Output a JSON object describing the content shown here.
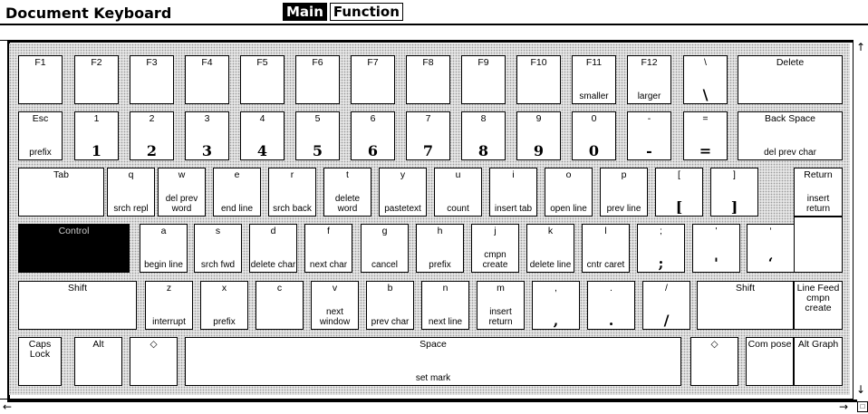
{
  "window": {
    "title": "Document Keyboard"
  },
  "tabs": [
    {
      "label": "Main",
      "active": true
    },
    {
      "label": "Function",
      "active": false
    }
  ],
  "scroll": {
    "up": "↑",
    "down": "↓",
    "left": "←",
    "right": "→",
    "corner": "□"
  },
  "keys": [
    {
      "name": "key-f1",
      "top": "F1",
      "bottom": ""
    },
    {
      "name": "key-f2",
      "top": "F2",
      "bottom": ""
    },
    {
      "name": "key-f3",
      "top": "F3",
      "bottom": ""
    },
    {
      "name": "key-f4",
      "top": "F4",
      "bottom": ""
    },
    {
      "name": "key-f5",
      "top": "F5",
      "bottom": ""
    },
    {
      "name": "key-f6",
      "top": "F6",
      "bottom": ""
    },
    {
      "name": "key-f7",
      "top": "F7",
      "bottom": ""
    },
    {
      "name": "key-f8",
      "top": "F8",
      "bottom": ""
    },
    {
      "name": "key-f9",
      "top": "F9",
      "bottom": ""
    },
    {
      "name": "key-f10",
      "top": "F10",
      "bottom": ""
    },
    {
      "name": "key-f11",
      "top": "F11",
      "bottom": "smaller"
    },
    {
      "name": "key-f12",
      "top": "F12",
      "bottom": "larger"
    },
    {
      "name": "key-backslash",
      "top": "\\",
      "bottom": "\\"
    },
    {
      "name": "key-delete",
      "top": "Delete",
      "bottom": ""
    },
    {
      "name": "key-esc",
      "top": "Esc",
      "bottom": "prefix"
    },
    {
      "name": "key-1",
      "top": "1",
      "bottom": "1"
    },
    {
      "name": "key-2",
      "top": "2",
      "bottom": "2"
    },
    {
      "name": "key-3",
      "top": "3",
      "bottom": "3"
    },
    {
      "name": "key-4",
      "top": "4",
      "bottom": "4"
    },
    {
      "name": "key-5",
      "top": "5",
      "bottom": "5"
    },
    {
      "name": "key-6",
      "top": "6",
      "bottom": "6"
    },
    {
      "name": "key-7",
      "top": "7",
      "bottom": "7"
    },
    {
      "name": "key-8",
      "top": "8",
      "bottom": "8"
    },
    {
      "name": "key-9",
      "top": "9",
      "bottom": "9"
    },
    {
      "name": "key-0",
      "top": "0",
      "bottom": "0"
    },
    {
      "name": "key-minus",
      "top": "-",
      "bottom": "-"
    },
    {
      "name": "key-equals",
      "top": "=",
      "bottom": "="
    },
    {
      "name": "key-backspace",
      "top": "Back Space",
      "bottom": "del prev char"
    },
    {
      "name": "key-tab",
      "top": "Tab",
      "bottom": ""
    },
    {
      "name": "key-q",
      "top": "q",
      "bottom": "srch repl"
    },
    {
      "name": "key-w",
      "top": "w",
      "bottom": "del prev word"
    },
    {
      "name": "key-e",
      "top": "e",
      "bottom": "end line"
    },
    {
      "name": "key-r",
      "top": "r",
      "bottom": "srch back"
    },
    {
      "name": "key-t",
      "top": "t",
      "bottom": "delete word"
    },
    {
      "name": "key-y",
      "top": "y",
      "bottom": "pastetext"
    },
    {
      "name": "key-u",
      "top": "u",
      "bottom": "count"
    },
    {
      "name": "key-i",
      "top": "i",
      "bottom": "insert tab"
    },
    {
      "name": "key-o",
      "top": "o",
      "bottom": "open line"
    },
    {
      "name": "key-p",
      "top": "p",
      "bottom": "prev line"
    },
    {
      "name": "key-lbracket",
      "top": "[",
      "bottom": "["
    },
    {
      "name": "key-rbracket",
      "top": "]",
      "bottom": "]"
    },
    {
      "name": "key-return",
      "top": "Return",
      "bottom": "insert return"
    },
    {
      "name": "key-control",
      "top": "Control",
      "bottom": ""
    },
    {
      "name": "key-a",
      "top": "a",
      "bottom": "begin line"
    },
    {
      "name": "key-s",
      "top": "s",
      "bottom": "srch fwd"
    },
    {
      "name": "key-d",
      "top": "d",
      "bottom": "delete char"
    },
    {
      "name": "key-f",
      "top": "f",
      "bottom": "next char"
    },
    {
      "name": "key-g",
      "top": "g",
      "bottom": "cancel"
    },
    {
      "name": "key-h",
      "top": "h",
      "bottom": "prefix"
    },
    {
      "name": "key-j",
      "top": "j",
      "bottom": "cmpn create"
    },
    {
      "name": "key-k",
      "top": "k",
      "bottom": "delete line"
    },
    {
      "name": "key-l",
      "top": "l",
      "bottom": "cntr caret"
    },
    {
      "name": "key-semicolon",
      "top": ";",
      "bottom": ";"
    },
    {
      "name": "key-quote",
      "top": "'",
      "bottom": "'"
    },
    {
      "name": "key-backquote",
      "top": "‘",
      "bottom": "‘"
    },
    {
      "name": "key-return-ext",
      "top": "",
      "bottom": ""
    },
    {
      "name": "key-shift-left",
      "top": "Shift",
      "bottom": ""
    },
    {
      "name": "key-z",
      "top": "z",
      "bottom": "interrupt"
    },
    {
      "name": "key-x",
      "top": "x",
      "bottom": "prefix"
    },
    {
      "name": "key-c",
      "top": "c",
      "bottom": ""
    },
    {
      "name": "key-v",
      "top": "v",
      "bottom": "next window"
    },
    {
      "name": "key-b",
      "top": "b",
      "bottom": "prev char"
    },
    {
      "name": "key-n",
      "top": "n",
      "bottom": "next line"
    },
    {
      "name": "key-m",
      "top": "m",
      "bottom": "insert return"
    },
    {
      "name": "key-comma",
      "top": ",",
      "bottom": ","
    },
    {
      "name": "key-period",
      "top": ".",
      "bottom": "."
    },
    {
      "name": "key-slash",
      "top": "/",
      "bottom": "/"
    },
    {
      "name": "key-shift-right",
      "top": "Shift",
      "bottom": ""
    },
    {
      "name": "key-linefeed",
      "top": "Line Feed cmpn create",
      "bottom": ""
    },
    {
      "name": "key-capslock",
      "top": "Caps Lock",
      "bottom": ""
    },
    {
      "name": "key-alt",
      "top": "Alt",
      "bottom": ""
    },
    {
      "name": "key-diamond-left",
      "top": "◇",
      "bottom": ""
    },
    {
      "name": "key-space",
      "top": "Space",
      "bottom": "set mark"
    },
    {
      "name": "key-diamond-right",
      "top": "◇",
      "bottom": ""
    },
    {
      "name": "key-compose",
      "top": "Com pose",
      "bottom": ""
    },
    {
      "name": "key-altgraph",
      "top": "Alt Graph",
      "bottom": ""
    }
  ]
}
